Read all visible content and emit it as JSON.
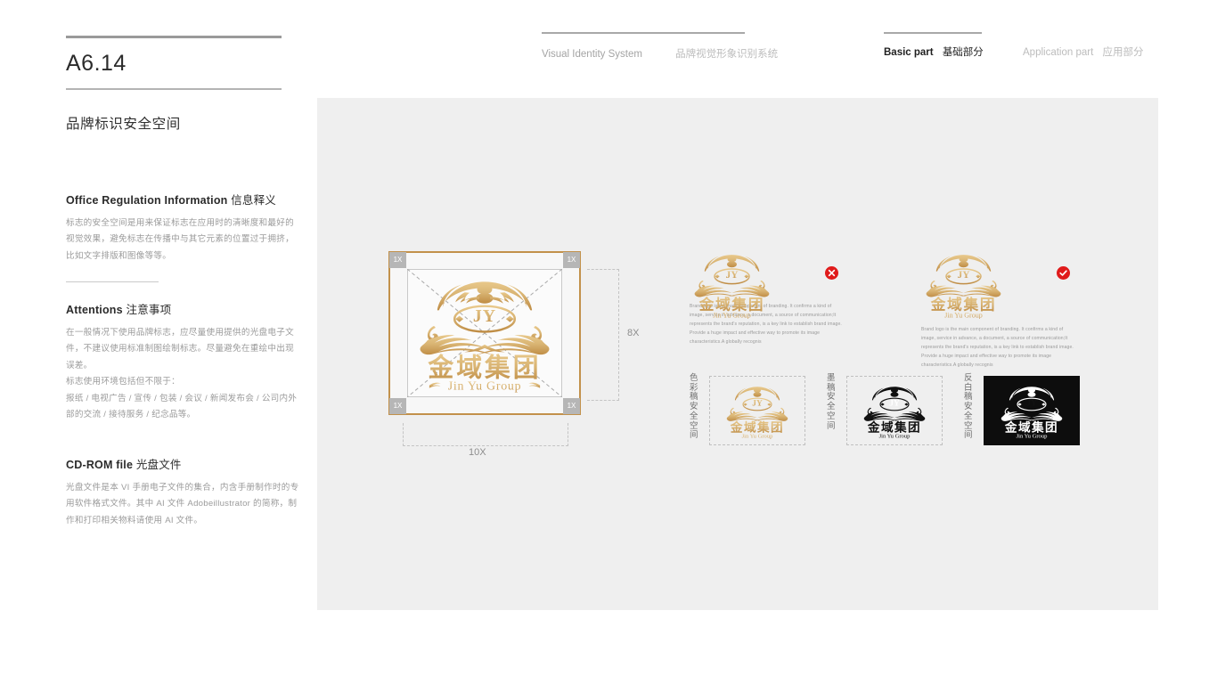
{
  "page": {
    "code": "A6.14",
    "subtitle": "品牌标识安全空间"
  },
  "header": {
    "system_en": "Visual Identity System",
    "system_cn": "品牌视觉形象识别系统",
    "nav": [
      {
        "en": "Basic part",
        "cn": "基础部分",
        "active": true
      },
      {
        "en": "Application part",
        "cn": "应用部分",
        "active": false
      }
    ]
  },
  "sections": [
    {
      "title_en": "Office Regulation Information",
      "title_cn": "信息释义",
      "body": "标志的安全空间是用来保证标志在应用时的清晰度和最好的视觉效果，避免标志在传播中与其它元素的位置过于拥挤，比如文字排版和图像等等。"
    },
    {
      "title_en": "Attentions",
      "title_cn": "注意事项",
      "body_1": "在一般情况下使用品牌标志，应尽量使用提供的光盘电子文件，不建议使用标准制图绘制标志。尽量避免在重绘中出现误差。",
      "body_2": "标志使用环境包括但不限于：",
      "body_3": "报纸 / 电视广告 / 宣传 / 包装 / 会议 / 新闻发布会 / 公司内外部的交流 / 接待服务 / 纪念品等。"
    },
    {
      "title_en": "CD-ROM file",
      "title_cn": "光盘文件",
      "body": "光盘文件是本 VI 手册电子文件的集合，内含手册制作时的专用软件格式文件。其中 AI 文件 Adobeillustrator 的简称，制作和打印相关物料请使用 AI 文件。"
    }
  ],
  "diagram": {
    "corner_marks": [
      "1X",
      "1X",
      "1X",
      "1X"
    ],
    "dimension_height": "8X",
    "dimension_width": "10X"
  },
  "logo": {
    "name_cn": "金域集团",
    "name_en": "Jin Yu Group",
    "monogram": "JY"
  },
  "examples": [
    {
      "status": "incorrect",
      "mark_icon": "cross-circle-icon",
      "paragraph": "Brand logo is the main component of branding. It confirms a kind of image, service in advance, a document, a source of communication;It represents the brand's reputation, is a key link to establish brand image. Provide a huge impact and effective way to promote its image characteristics.A globally recognis"
    },
    {
      "status": "correct",
      "mark_icon": "check-circle-icon",
      "paragraph": "Brand logo is the main component of branding. It confirms a kind of image, service in advance, a document, a source of communication;It represents the brand's reputation, is a key link to establish brand image. Provide a huge impact and effective way to promote its image characteristics.A globally recognis"
    }
  ],
  "variants": [
    {
      "label": "色彩稿安全空间",
      "style": "color"
    },
    {
      "label": "墨稿安全空间",
      "style": "mono"
    },
    {
      "label": "反白稿安全空间",
      "style": "reverse"
    }
  ],
  "colors": {
    "canvas": "#efefef",
    "gold_dark": "#c2914b",
    "gold_light": "#e8c88a",
    "mark_red": "#e01b1b",
    "frame_gray": "#b6b6b6"
  }
}
